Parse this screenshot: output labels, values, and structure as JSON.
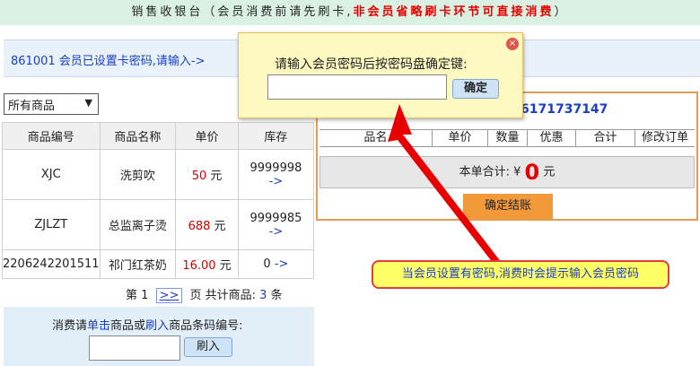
{
  "banner": {
    "normal": "销售收银台（会员消费前请先刷卡,",
    "warning": "非会员省略刷卡环节可直接消费",
    "end": "）"
  },
  "info": {
    "message": "861001 会员已设置卡密码,请输入->"
  },
  "filter": {
    "selected": "所有商品"
  },
  "goods": {
    "headers": [
      "商品编号",
      "商品名称",
      "单价",
      "库存"
    ],
    "rows": [
      {
        "code": "XJC",
        "name": "洗剪吹",
        "price": "50",
        "unit": "元",
        "stock": "9999998",
        "arrow": "->"
      },
      {
        "code": "ZJLZT",
        "name": "总监离子烫",
        "price": "688",
        "unit": "元",
        "stock": "9999985",
        "arrow": "->"
      },
      {
        "code": "2206242201511",
        "name": "祁门红茶奶",
        "price": "16.00",
        "unit": "元",
        "stock": "0",
        "arrow": "->"
      }
    ]
  },
  "pager": {
    "page_label": "第 1",
    "next": ">>",
    "suffix": "页 共计商品:",
    "count": "3",
    "count_unit": "条"
  },
  "scan": {
    "prefix": "消费请",
    "click": "单击",
    "mid": "商品或",
    "swipe": "刷入",
    "suffix": "商品条码编号:",
    "button": "刷入"
  },
  "order": {
    "card_no": "6171737147",
    "headers": [
      "品名",
      "单价",
      "数量",
      "优惠",
      "合计",
      "修改订单"
    ],
    "total_label": "本单合计: ¥",
    "total_value": "0",
    "total_unit": "元",
    "checkout": "确定结账"
  },
  "popup": {
    "prompt": "请输入会员密码后按密码盘确定键:",
    "ok": "确定",
    "close": "×"
  },
  "callout": {
    "text": "当会员设置有密码,消费时会提示输入会员密码"
  }
}
